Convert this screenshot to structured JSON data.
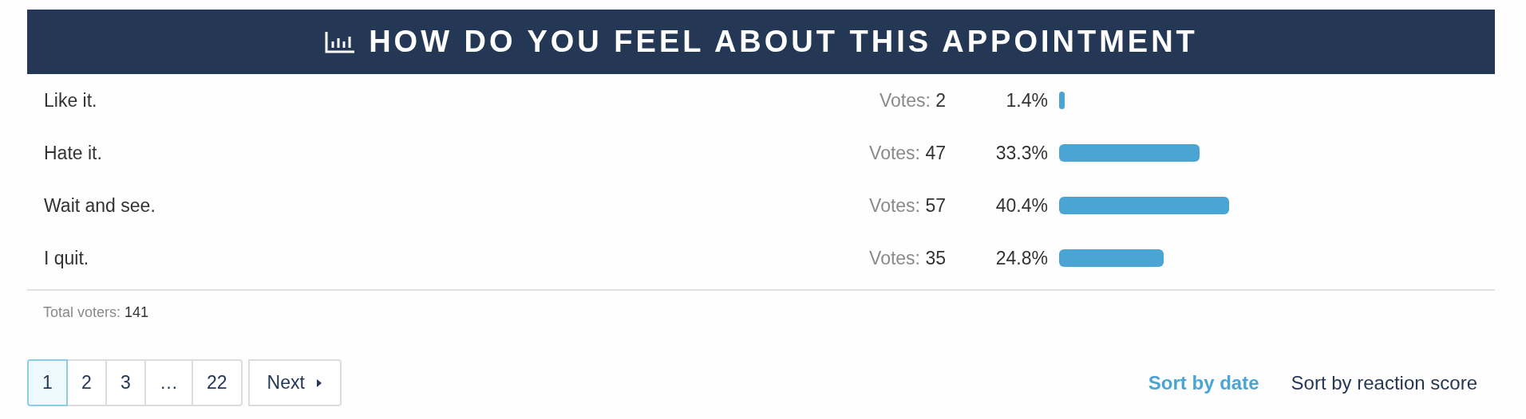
{
  "title": "HOW DO YOU FEEL ABOUT THIS APPOINTMENT",
  "options": [
    {
      "label": "Like it.",
      "votes_label": "Votes:",
      "votes": "2",
      "percent": "1.4%"
    },
    {
      "label": "Hate it.",
      "votes_label": "Votes:",
      "votes": "47",
      "percent": "33.3%"
    },
    {
      "label": "Wait and see.",
      "votes_label": "Votes:",
      "votes": "57",
      "percent": "40.4%"
    },
    {
      "label": "I quit.",
      "votes_label": "Votes:",
      "votes": "35",
      "percent": "24.8%"
    }
  ],
  "total": {
    "label": "Total voters:",
    "value": "141"
  },
  "pagination": {
    "pages": [
      {
        "label": "1",
        "selected": true
      },
      {
        "label": "2",
        "selected": false
      },
      {
        "label": "3",
        "selected": false
      },
      {
        "label": "…",
        "selected": false
      },
      {
        "label": "22",
        "selected": false
      }
    ],
    "next": "Next"
  },
  "sort": [
    {
      "label": "Sort by date",
      "selected": true
    },
    {
      "label": "Sort by reaction score",
      "selected": false
    }
  ]
}
